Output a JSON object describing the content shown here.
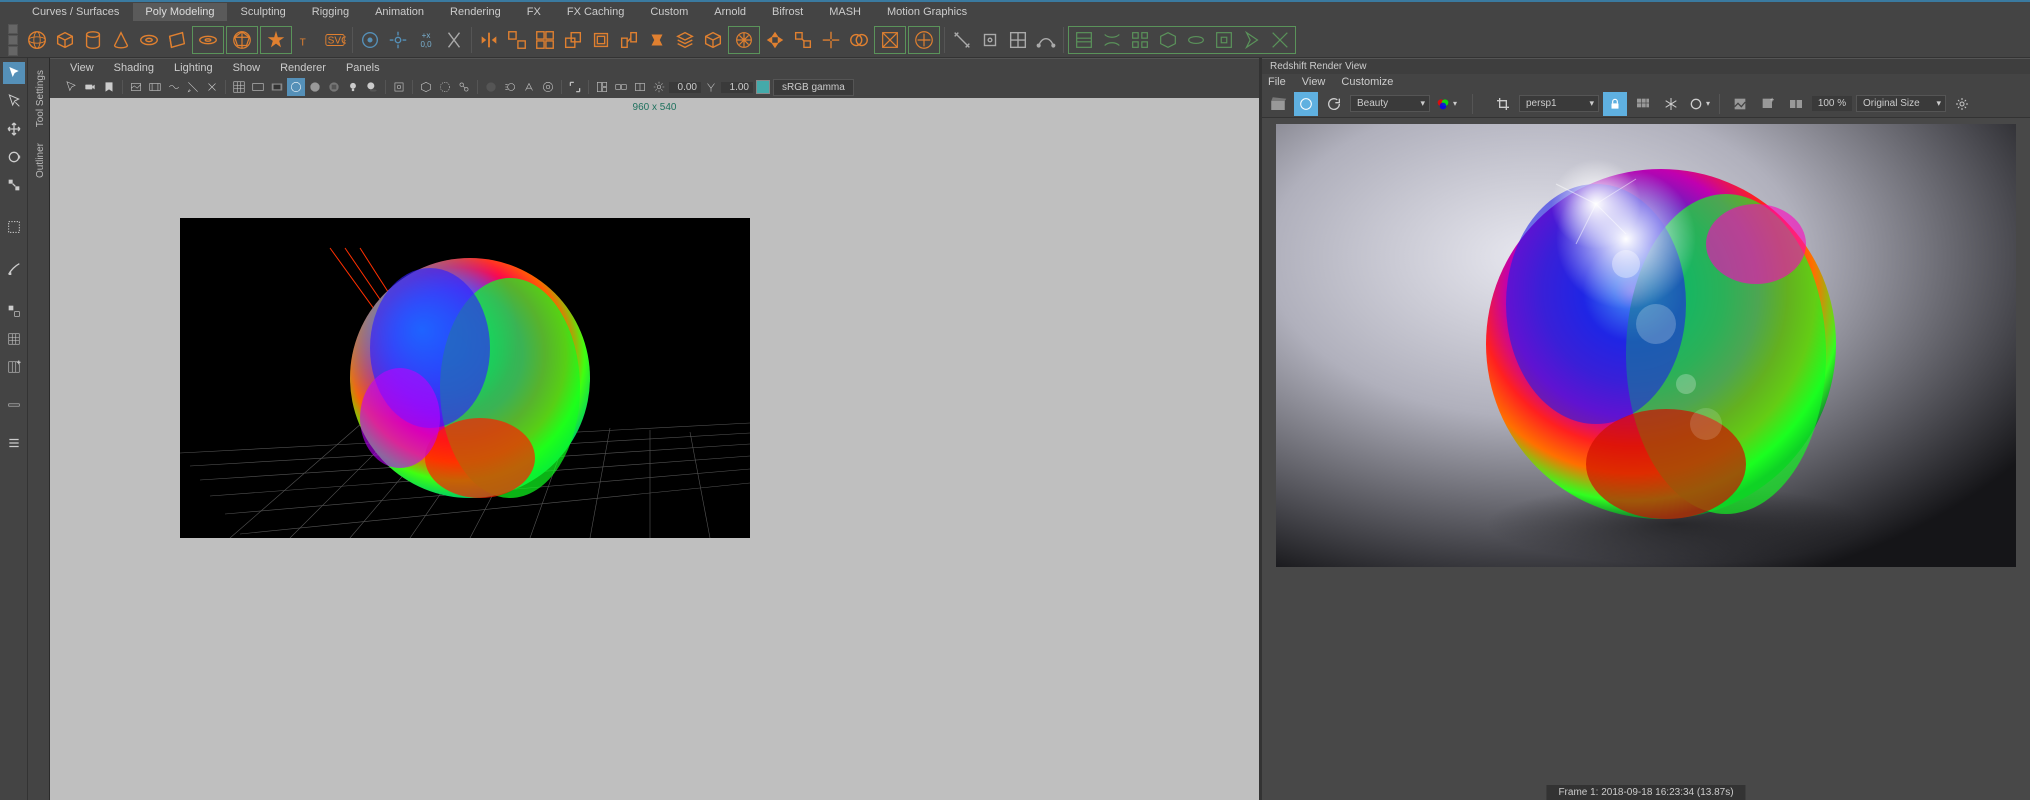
{
  "tabs": {
    "items": [
      "Curves / Surfaces",
      "Poly Modeling",
      "Sculpting",
      "Rigging",
      "Animation",
      "Rendering",
      "FX",
      "FX Caching",
      "Custom",
      "Arnold",
      "Bifrost",
      "MASH",
      "Motion Graphics"
    ],
    "active_index": 1
  },
  "viewport": {
    "menus": [
      "View",
      "Shading",
      "Lighting",
      "Show",
      "Renderer",
      "Panels"
    ],
    "resolution_label": "960 x 540",
    "value1": "0.00",
    "value2": "1.00",
    "gamma_button": "sRGB gamma"
  },
  "side_tabs": [
    "Tool Settings",
    "Outliner"
  ],
  "render": {
    "panel_title": "Redshift Render View",
    "menus": [
      "File",
      "View",
      "Customize"
    ],
    "aov_dropdown": "Beauty",
    "camera_dropdown": "persp1",
    "zoom": "100 %",
    "size_dropdown": "Original Size",
    "status": "Frame  1:  2018-09-18  16:23:34  (13.87s)"
  }
}
